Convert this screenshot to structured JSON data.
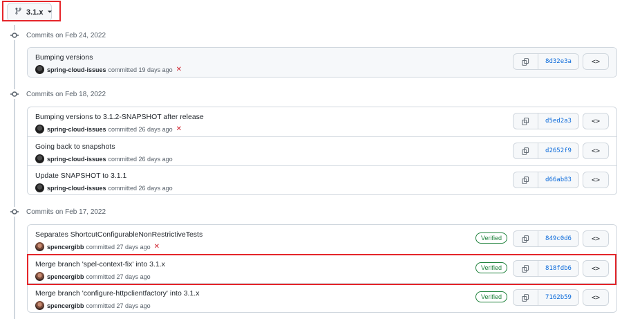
{
  "branch": {
    "name": "3.1.x"
  },
  "groups": [
    {
      "header": "Commits on Feb 24, 2022",
      "commits": [
        {
          "title": "Bumping versions",
          "author": "spring-cloud-issues",
          "verb": "committed",
          "time": "19 days ago",
          "status": "✕",
          "verified": "",
          "sha": "8d32e3a"
        }
      ]
    },
    {
      "header": "Commits on Feb 18, 2022",
      "commits": [
        {
          "title": "Bumping versions to 3.1.2-SNAPSHOT after release",
          "author": "spring-cloud-issues",
          "verb": "committed",
          "time": "26 days ago",
          "status": "✕",
          "verified": "",
          "sha": "d5ed2a3"
        },
        {
          "title": "Going back to snapshots",
          "author": "spring-cloud-issues",
          "verb": "committed",
          "time": "26 days ago",
          "status": "",
          "verified": "",
          "sha": "d2652f9"
        },
        {
          "title": "Update SNAPSHOT to 3.1.1",
          "author": "spring-cloud-issues",
          "verb": "committed",
          "time": "26 days ago",
          "status": "",
          "verified": "",
          "sha": "d66ab83"
        }
      ]
    },
    {
      "header": "Commits on Feb 17, 2022",
      "commits": [
        {
          "title": "Separates ShortcutConfigurableNonRestrictiveTests",
          "author": "spencergibb",
          "verb": "committed",
          "time": "27 days ago",
          "status": "✕",
          "verified": "Verified",
          "sha": "849c0d6"
        },
        {
          "title": "Merge branch 'spel-context-fix' into 3.1.x",
          "author": "spencergibb",
          "verb": "committed",
          "time": "27 days ago",
          "status": "",
          "verified": "Verified",
          "sha": "818fdb6"
        },
        {
          "title": "Merge branch 'configure-httpclientfactory' into 3.1.x",
          "author": "spencergibb",
          "verb": "committed",
          "time": "27 days ago",
          "status": "",
          "verified": "Verified",
          "sha": "7162b59"
        }
      ]
    }
  ],
  "icons": {
    "branch": "git-branch-icon",
    "dropdown": "caret-down-icon",
    "copy": "copy-icon",
    "browse": "code-icon",
    "node": "commit-node-icon"
  },
  "colors": {
    "highlight": "#e5252a",
    "verified": "#1a7f37",
    "sha": "#0969da",
    "failed": "#cf222e"
  }
}
